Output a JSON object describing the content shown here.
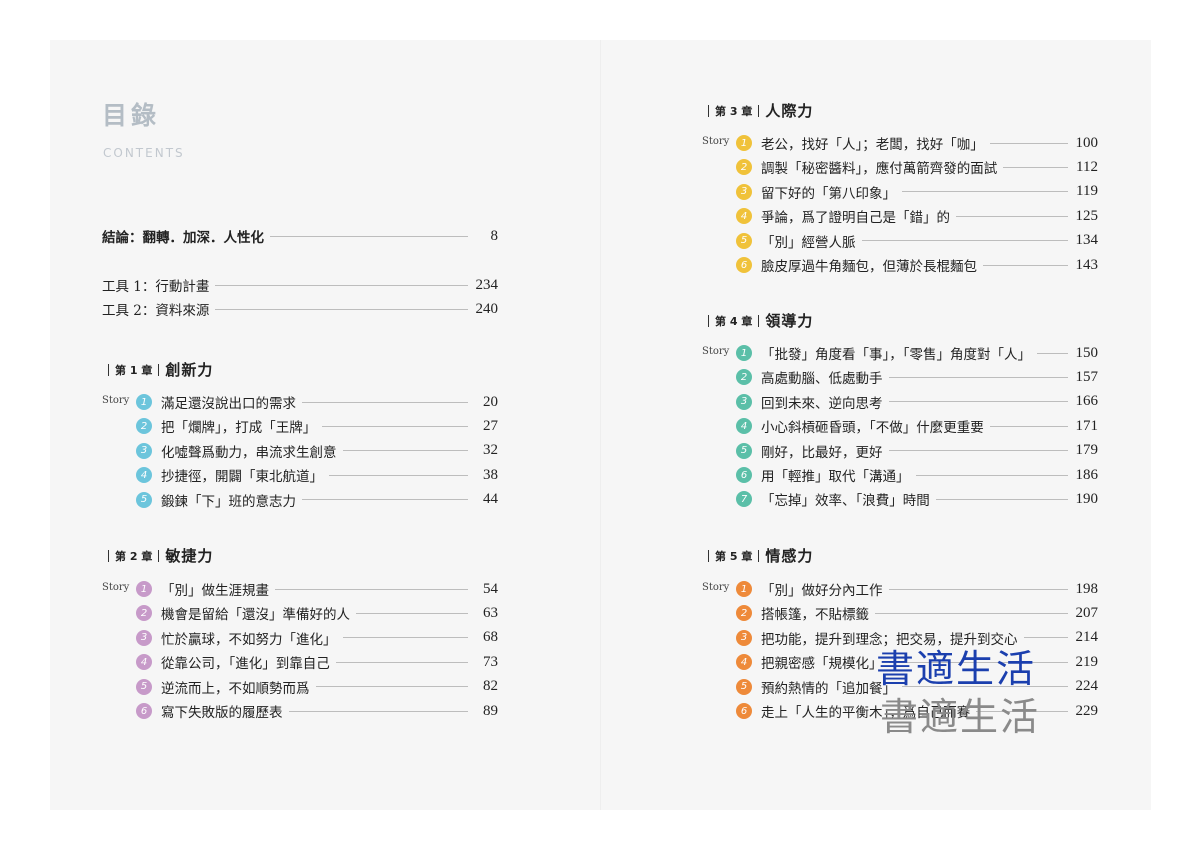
{
  "header": {
    "title": "目錄",
    "subtitle": "CONTENTS"
  },
  "front": [
    {
      "text": "結論：翻轉．加深．人性化",
      "page": "8"
    },
    {
      "text": "工具 1：行動計畫",
      "page": "234"
    },
    {
      "text": "工具 2：資料來源",
      "page": "240"
    }
  ],
  "story_label": "Story",
  "chapters": [
    {
      "num": "第 1 章",
      "name": "創新力",
      "color": "#6cc5dc",
      "items": [
        {
          "n": "1",
          "text": "滿足還沒說出口的需求",
          "page": "20"
        },
        {
          "n": "2",
          "text": "把「爛牌」，打成「王牌」",
          "page": "27"
        },
        {
          "n": "3",
          "text": "化噓聲爲動力，串流求生創意",
          "page": "32"
        },
        {
          "n": "4",
          "text": "抄捷徑，開闢「東北航道」",
          "page": "38"
        },
        {
          "n": "5",
          "text": "鍛鍊「下」班的意志力",
          "page": "44"
        }
      ]
    },
    {
      "num": "第 2 章",
      "name": "敏捷力",
      "color": "#c79ac9",
      "items": [
        {
          "n": "1",
          "text": "「別」做生涯規畫",
          "page": "54"
        },
        {
          "n": "2",
          "text": "機會是留給「還沒」準備好的人",
          "page": "63"
        },
        {
          "n": "3",
          "text": "忙於贏球，不如努力「進化」",
          "page": "68"
        },
        {
          "n": "4",
          "text": "從靠公司，「進化」到靠自己",
          "page": "73"
        },
        {
          "n": "5",
          "text": "逆流而上，不如順勢而爲",
          "page": "82"
        },
        {
          "n": "6",
          "text": "寫下失敗版的履歷表",
          "page": "89"
        }
      ]
    },
    {
      "num": "第 3 章",
      "name": "人際力",
      "color": "#f0c23a",
      "items": [
        {
          "n": "1",
          "text": "老公，找好「人」；老闆，找好「咖」",
          "page": "100"
        },
        {
          "n": "2",
          "text": "調製「秘密醬料」，應付萬箭齊發的面試",
          "page": "112"
        },
        {
          "n": "3",
          "text": "留下好的「第八印象」",
          "page": "119"
        },
        {
          "n": "4",
          "text": "爭論，爲了證明自己是「錯」的",
          "page": "125"
        },
        {
          "n": "5",
          "text": "「別」經營人脈",
          "page": "134"
        },
        {
          "n": "6",
          "text": "臉皮厚過牛角麵包，但薄於長棍麵包",
          "page": "143"
        }
      ]
    },
    {
      "num": "第 4 章",
      "name": "領導力",
      "color": "#5bbfa8",
      "items": [
        {
          "n": "1",
          "text": "「批發」角度看「事」，「零售」角度對「人」",
          "page": "150"
        },
        {
          "n": "2",
          "text": "高處動腦、低處動手",
          "page": "157"
        },
        {
          "n": "3",
          "text": "回到未來、逆向思考",
          "page": "166"
        },
        {
          "n": "4",
          "text": "小心斜槓砸昏頭，「不做」什麼更重要",
          "page": "171"
        },
        {
          "n": "5",
          "text": "剛好，比最好，更好",
          "page": "179"
        },
        {
          "n": "6",
          "text": "用「輕推」取代「溝通」",
          "page": "186"
        },
        {
          "n": "7",
          "text": "「忘掉」效率、「浪費」時間",
          "page": "190"
        }
      ]
    },
    {
      "num": "第 5 章",
      "name": "情感力",
      "color": "#ee8a3a",
      "items": [
        {
          "n": "1",
          "text": "「別」做好分內工作",
          "page": "198"
        },
        {
          "n": "2",
          "text": "搭帳篷，不貼標籤",
          "page": "207"
        },
        {
          "n": "3",
          "text": "把功能，提升到理念；把交易，提升到交心",
          "page": "214"
        },
        {
          "n": "4",
          "text": "把親密感「規模化」",
          "page": "219"
        },
        {
          "n": "5",
          "text": "預約熱情的「追加餐」",
          "page": "224"
        },
        {
          "n": "6",
          "text": "走上「人生的平衡木」，爲自己而賽",
          "page": "229"
        }
      ]
    }
  ],
  "watermark": {
    "text1": "書適生活",
    "text2": "書適生活"
  }
}
